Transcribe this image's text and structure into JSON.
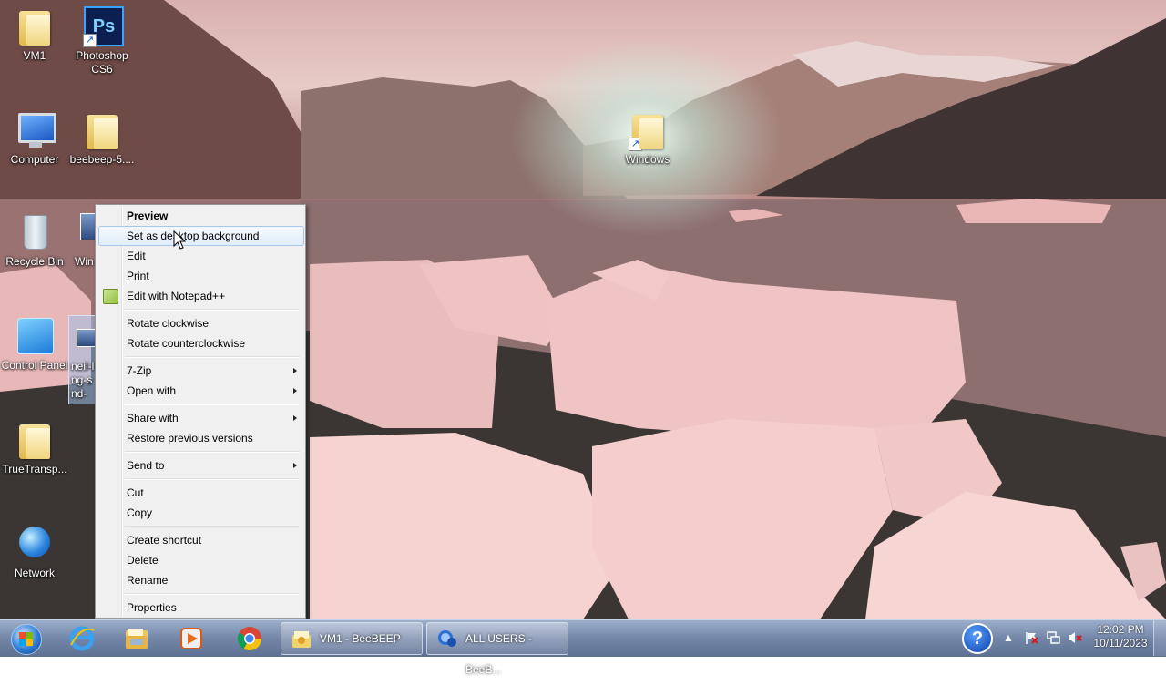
{
  "desktop": {
    "icons": [
      {
        "id": "vm1",
        "label": "VM1"
      },
      {
        "id": "photoshop",
        "label": "Photoshop CS6"
      },
      {
        "id": "computer",
        "label": "Computer"
      },
      {
        "id": "beebeep",
        "label": "beebeep-5...."
      },
      {
        "id": "windows",
        "label": "Windows"
      },
      {
        "id": "recycle",
        "label": "Recycle Bin"
      },
      {
        "id": "win-partial",
        "label": "Win"
      },
      {
        "id": "control-panel",
        "label": "Control Panel"
      },
      {
        "id": "neil-file",
        "label": "neil-l ng-s nd-"
      },
      {
        "id": "truetransp",
        "label": "TrueTransp..."
      },
      {
        "id": "network",
        "label": "Network"
      }
    ]
  },
  "context_menu": {
    "items": [
      {
        "label": "Preview",
        "bold": true
      },
      {
        "label": "Set as desktop background",
        "highlighted": true
      },
      {
        "label": "Edit"
      },
      {
        "label": "Print"
      },
      {
        "label": "Edit with Notepad++",
        "icon": "notepadpp-icon"
      },
      {
        "label": "Rotate clockwise"
      },
      {
        "label": "Rotate counterclockwise"
      },
      {
        "label": "7-Zip",
        "submenu": true
      },
      {
        "label": "Open with",
        "submenu": true
      },
      {
        "label": "Share with",
        "submenu": true
      },
      {
        "label": "Restore previous versions"
      },
      {
        "label": "Send to",
        "submenu": true
      },
      {
        "label": "Cut"
      },
      {
        "label": "Copy"
      },
      {
        "label": "Create shortcut"
      },
      {
        "label": "Delete"
      },
      {
        "label": "Rename"
      },
      {
        "label": "Properties"
      }
    ]
  },
  "taskbar": {
    "pinned": [
      "internet-explorer-icon",
      "windows-explorer-icon",
      "media-player-icon",
      "chrome-icon"
    ],
    "windows": [
      {
        "label": "VM1 - BeeBEEP",
        "icon": "beebeep-icon"
      },
      {
        "label": "ALL USERS - BeeB...",
        "icon": "beebeep-users-icon"
      }
    ],
    "help_glyph": "?",
    "clock": {
      "time": "12:02 PM",
      "date": "10/11/2023"
    }
  }
}
